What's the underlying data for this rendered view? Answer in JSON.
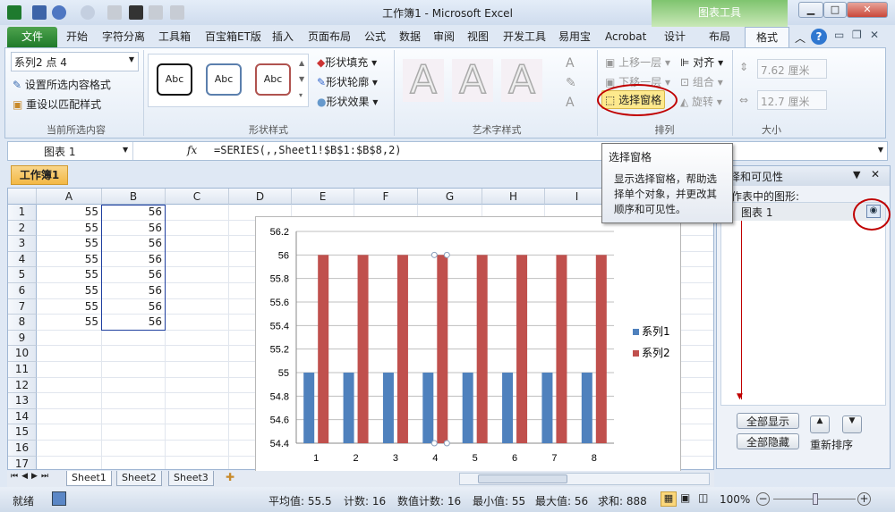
{
  "window": {
    "title": "工作簿1 - Microsoft Excel",
    "context_tab": "图表工具"
  },
  "tabs": [
    "文件",
    "开始",
    "字符分离",
    "工具箱",
    "百宝箱ET版",
    "插入",
    "页面布局",
    "公式",
    "数据",
    "审阅",
    "视图",
    "开发工具",
    "易用宝",
    "Acrobat",
    "设计",
    "布局",
    "格式"
  ],
  "ribbon": {
    "current_selection": {
      "dropdown": "系列2 点 4",
      "format_selection": "设置所选内容格式",
      "reset_style": "重设以匹配样式",
      "label": "当前所选内容"
    },
    "shape_styles": {
      "samples": [
        "Abc",
        "Abc",
        "Abc"
      ],
      "fill": "形状填充",
      "outline": "形状轮廓",
      "effects": "形状效果",
      "label": "形状样式"
    },
    "wordart": {
      "samples": [
        "A",
        "A",
        "A"
      ],
      "label": "艺术字样式"
    },
    "arrange": {
      "bring_forward": "上移一层",
      "send_backward": "下移一层",
      "selection_pane": "选择窗格",
      "align": "对齐",
      "group": "组合",
      "rotate": "旋转",
      "label": "排列"
    },
    "size": {
      "height": "7.62 厘米",
      "width": "12.7 厘米",
      "label": "大小"
    }
  },
  "formula_bar": {
    "name_box": "图表 1",
    "fx": "fx",
    "formula": "=SERIES(,,Sheet1!$B$1:$B$8,2)"
  },
  "workbook_tab": "工作簿1",
  "sheet": {
    "columns": [
      "A",
      "B",
      "C",
      "D",
      "E",
      "F",
      "G",
      "H",
      "I"
    ],
    "rows": [
      "1",
      "2",
      "3",
      "4",
      "5",
      "6",
      "7",
      "8",
      "9",
      "10",
      "11",
      "12",
      "13",
      "14",
      "15",
      "16",
      "17"
    ],
    "data": [
      [
        "55",
        "56"
      ],
      [
        "55",
        "56"
      ],
      [
        "55",
        "56"
      ],
      [
        "55",
        "56"
      ],
      [
        "55",
        "56"
      ],
      [
        "55",
        "56"
      ],
      [
        "55",
        "56"
      ],
      [
        "55",
        "56"
      ]
    ]
  },
  "chart_data": {
    "type": "bar",
    "categories": [
      "1",
      "2",
      "3",
      "4",
      "5",
      "6",
      "7",
      "8"
    ],
    "series": [
      {
        "name": "系列1",
        "values": [
          55,
          55,
          55,
          55,
          55,
          55,
          55,
          55
        ],
        "color": "#4f81bd"
      },
      {
        "name": "系列2",
        "values": [
          56,
          56,
          56,
          56,
          56,
          56,
          56,
          56
        ],
        "color": "#c0504d"
      }
    ],
    "ylim": [
      54.4,
      56.2
    ],
    "yticks": [
      "54.4",
      "54.6",
      "54.8",
      "55",
      "55.2",
      "55.4",
      "55.6",
      "55.8",
      "56",
      "56.2"
    ],
    "grid": true,
    "legend": "right",
    "selected_point": "系列2 点 4"
  },
  "tooltip": {
    "title": "选择窗格",
    "body": "显示选择窗格，帮助选择单个对象，并更改其顺序和可见性。"
  },
  "selection_pane": {
    "title": "择和可见性",
    "subtitle": "作表中的图形:",
    "items": [
      "图表 1"
    ],
    "show_all": "全部显示",
    "hide_all": "全部隐藏",
    "reorder": "重新排序"
  },
  "sheet_tabs": [
    "Sheet1",
    "Sheet2",
    "Sheet3"
  ],
  "status": {
    "ready": "就绪",
    "average": "平均值: 55.5",
    "count": "计数: 16",
    "numeric_count": "数值计数: 16",
    "min": "最小值: 55",
    "max": "最大值: 56",
    "sum": "求和: 888",
    "zoom": "100%"
  },
  "colors": {
    "file_tab": "#2a8a34",
    "highlight_circle": "#c00000",
    "series1": "#4f81bd",
    "series2": "#c0504d"
  }
}
